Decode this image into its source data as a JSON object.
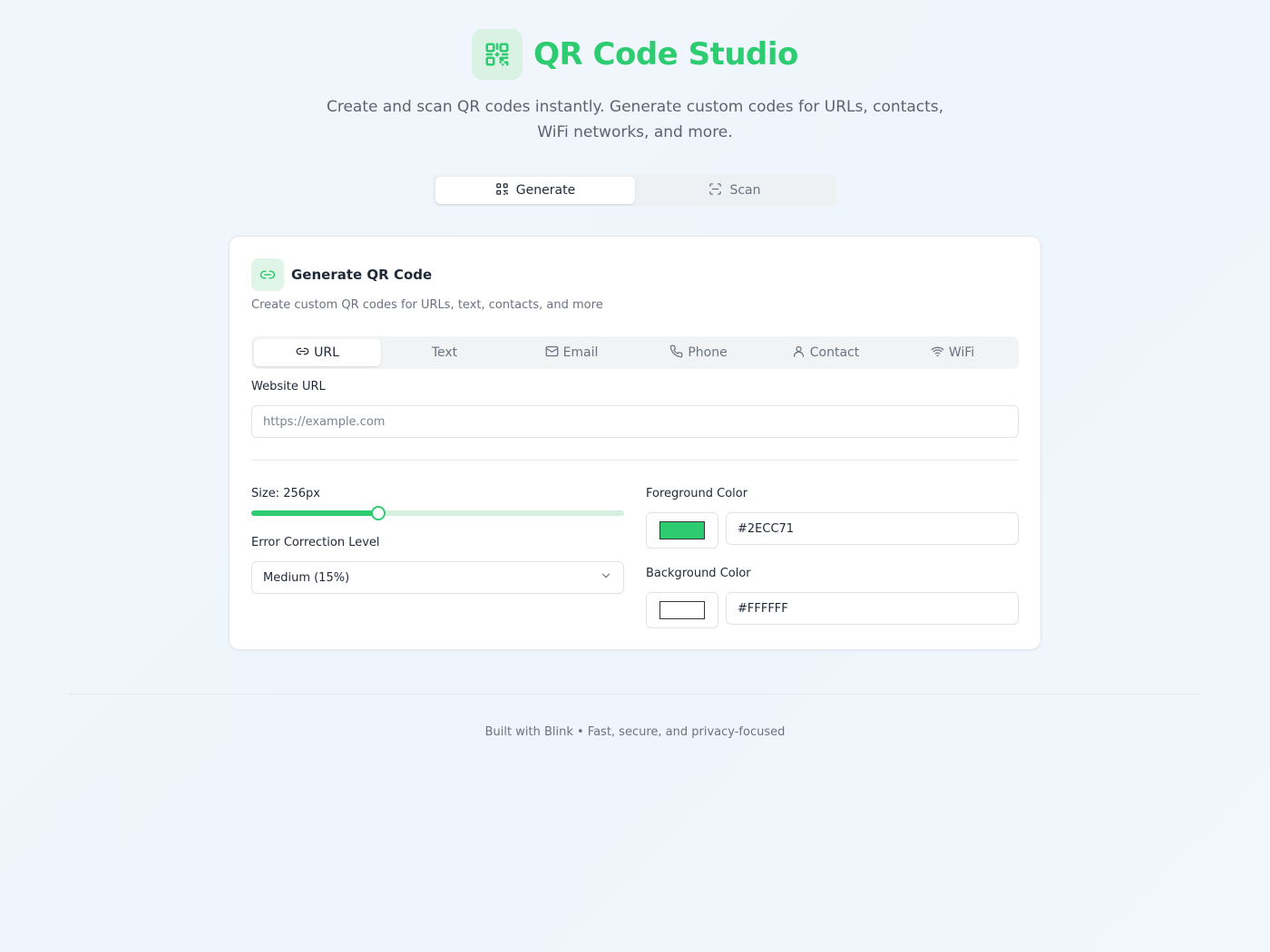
{
  "header": {
    "title": "QR Code Studio",
    "subtitle": "Create and scan QR codes instantly. Generate custom codes for URLs, contacts, WiFi networks, and more.",
    "logo_icon": "qr-code-icon",
    "accent": "#2ECC71"
  },
  "main_tabs": [
    {
      "label": "Generate",
      "icon": "qr-code-icon",
      "active": true
    },
    {
      "label": "Scan",
      "icon": "scan-icon",
      "active": false
    }
  ],
  "card": {
    "icon": "link-icon",
    "title": "Generate QR Code",
    "description": "Create custom QR codes for URLs, text, contacts, and more",
    "type_tabs": [
      {
        "label": "URL",
        "icon": "link-icon",
        "active": true
      },
      {
        "label": "Text",
        "icon": "",
        "active": false
      },
      {
        "label": "Email",
        "icon": "mail-icon",
        "active": false
      },
      {
        "label": "Phone",
        "icon": "phone-icon",
        "active": false
      },
      {
        "label": "Contact",
        "icon": "user-icon",
        "active": false
      },
      {
        "label": "WiFi",
        "icon": "wifi-icon",
        "active": false
      }
    ],
    "url": {
      "label": "Website URL",
      "placeholder": "https://example.com",
      "value": ""
    },
    "size": {
      "label": "Size: 256px",
      "fraction": 0.34
    },
    "error_correction": {
      "label": "Error Correction Level",
      "selected": "Medium (15%)"
    },
    "foreground": {
      "label": "Foreground Color",
      "value": "#2ECC71",
      "swatch": "#2ECC71"
    },
    "background": {
      "label": "Background Color",
      "value": "#FFFFFF",
      "swatch": "#FFFFFF"
    }
  },
  "footer": {
    "text": "Built with Blink • Fast, secure, and privacy-focused"
  }
}
